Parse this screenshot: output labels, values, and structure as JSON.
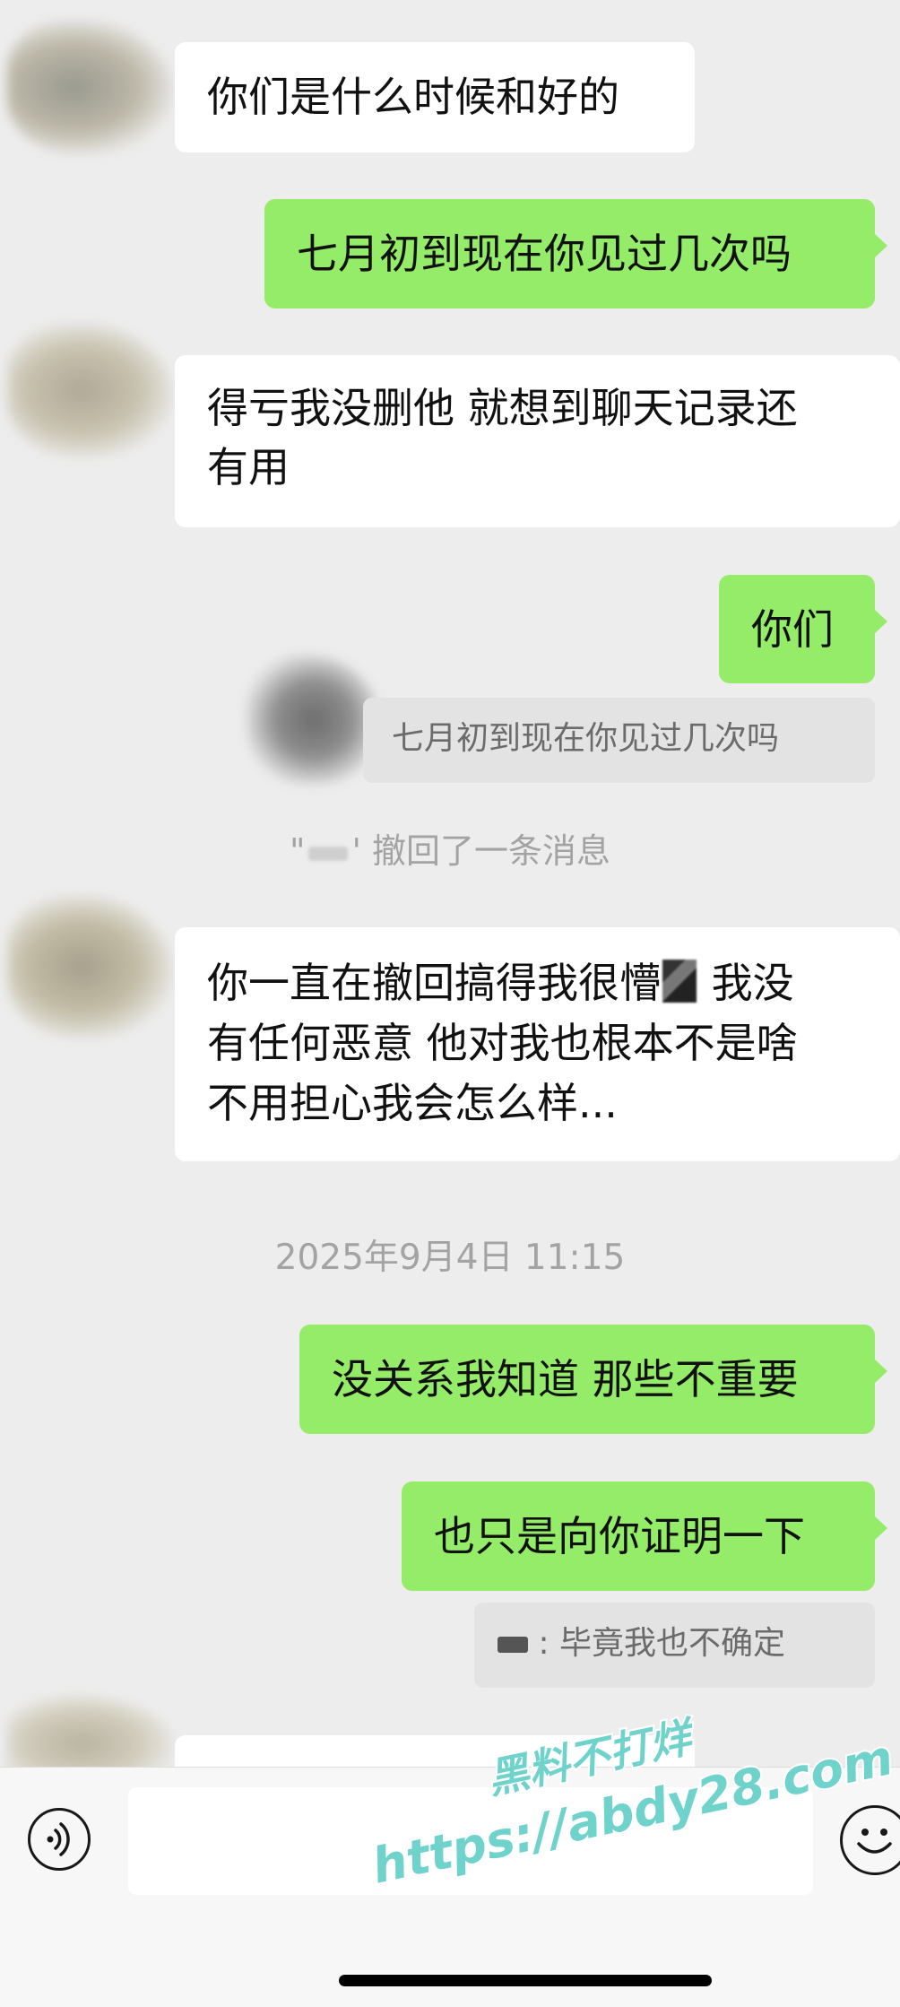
{
  "messages": [
    {
      "side": "in",
      "text": "你们是什么时候和好的"
    },
    {
      "side": "out",
      "text": "七月初到现在你见过几次吗"
    },
    {
      "side": "in",
      "line1": "得亏我没删他  就想到聊天记录还",
      "line2": "有用"
    },
    {
      "side": "out",
      "text": "你们"
    },
    {
      "side": "in",
      "line1a": "你一直在撤回搞得我很懵",
      "line1b": "  我没",
      "line2": "有任何恶意   他对我也根本不是啥",
      "line3": "不用担心我会怎么样..."
    },
    {
      "side": "out",
      "text": "没关系我知道 那些不重要"
    },
    {
      "side": "out",
      "text": "也只是向你证明一下"
    }
  ],
  "quotes": {
    "first": {
      "text": "七月初到现在你见过几次吗"
    },
    "second": {
      "text": "毕竟我也不确定"
    }
  },
  "system": {
    "recall_prefix": "\"",
    "recall_suffix": "' 撤回了一条消息",
    "timestamp": "2025年9月4日 11:15"
  },
  "input": {
    "placeholder": ""
  },
  "watermark": {
    "line1": "黑料不打烊",
    "line2": "https://abdy28.com"
  },
  "colors": {
    "out_bubble": "#95ec69",
    "in_bubble": "#ffffff",
    "background": "#ededed"
  },
  "icons": {
    "voice": "voice-icon",
    "emoji": "emoji-icon"
  }
}
